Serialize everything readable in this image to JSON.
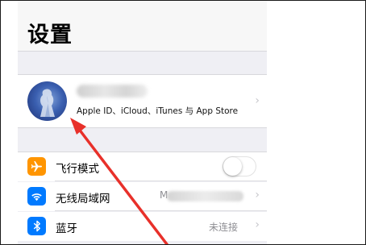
{
  "header": {
    "title": "设置"
  },
  "profile": {
    "subtitle": "Apple ID、iCloud、iTunes 与 App Store",
    "chevron": "›"
  },
  "rows": [
    {
      "label": "飞行模式",
      "icon": "airplane-icon",
      "icon_color": "#ff9500",
      "toggle_on": false
    },
    {
      "label": "无线局域网",
      "icon": "wifi-icon",
      "icon_color": "#007aff",
      "value_visible": "M",
      "chevron": "›"
    },
    {
      "label": "蓝牙",
      "icon": "bluetooth-icon",
      "icon_color": "#007aff",
      "value": "未连接",
      "chevron": "›"
    }
  ],
  "annotation": {
    "color": "#e8302a"
  }
}
